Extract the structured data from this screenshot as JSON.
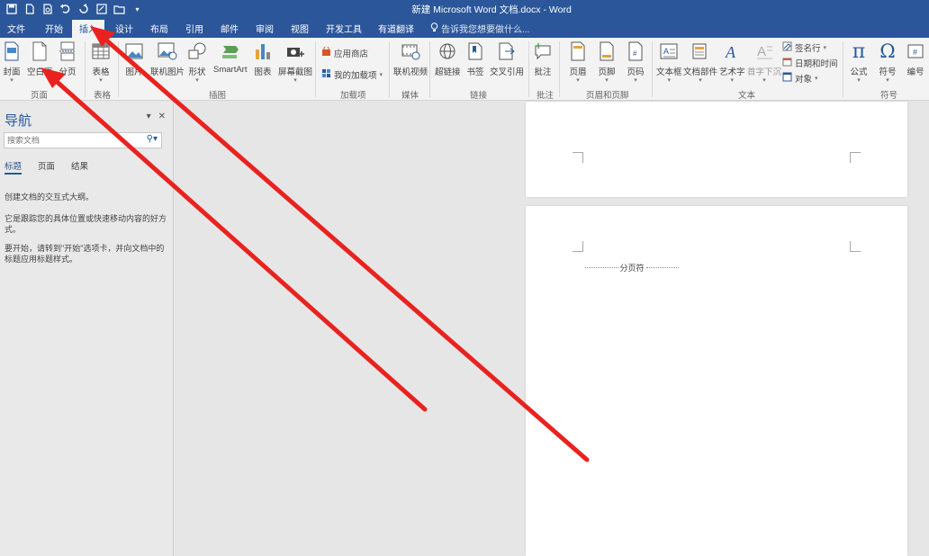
{
  "window": {
    "title": "新建 Microsoft Word 文档.docx - Word"
  },
  "tabs": [
    "文件",
    "开始",
    "插入",
    "设计",
    "布局",
    "引用",
    "邮件",
    "审阅",
    "视图",
    "开发工具",
    "有道翻译"
  ],
  "active_tab": "插入",
  "tell_me": "告诉我您想要做什么...",
  "ribbon": {
    "buttons": {
      "cover": "封面",
      "blank_page": "空白页",
      "page_break": "分页",
      "table": "表格",
      "picture": "图片",
      "online_picture": "联机图片",
      "shapes": "形状",
      "smartart": "SmartArt",
      "chart": "图表",
      "screenshot": "屏幕截图",
      "store": "应用商店",
      "my_addins": "我的加载项",
      "online_video": "联机视频",
      "hyperlink": "超链接",
      "bookmark": "书签",
      "cross_ref": "交叉引用",
      "comment": "批注",
      "header": "页眉",
      "footer": "页脚",
      "page_number": "页码",
      "textbox": "文本框",
      "quick_parts": "文档部件",
      "wordart": "艺术字",
      "drop_cap": "首字下沉",
      "signature_line": "签名行",
      "date_time": "日期和时间",
      "object": "对象",
      "equation": "公式",
      "symbol": "符号",
      "numbering": "编号"
    },
    "groups": {
      "pages": "页面",
      "tables": "表格",
      "illustrations": "插图",
      "addins": "加载项",
      "media": "媒体",
      "links": "链接",
      "comments": "批注",
      "header_footer": "页眉和页脚",
      "text": "文本",
      "symbols": "符号"
    }
  },
  "nav": {
    "title": "导航",
    "search_placeholder": "搜索文档",
    "tabs": [
      "标题",
      "页面",
      "结果"
    ],
    "line1": "创建文档的交互式大纲。",
    "line2": "它是跟踪您的具体位置或快速移动内容的好方式。",
    "line3": "要开始，请转到\"开始\"选项卡，并向文档中的标题应用标题样式。"
  },
  "document": {
    "page_break_label": "分页符"
  },
  "colors": {
    "word_blue": "#2b579a",
    "annotation_red": "#e8231f"
  }
}
